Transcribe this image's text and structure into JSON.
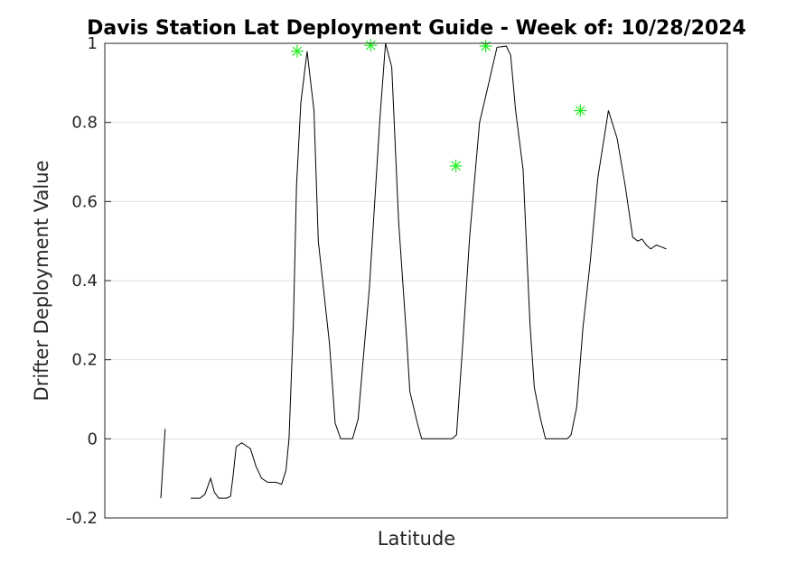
{
  "chart_data": {
    "type": "line",
    "title": "Davis Station Lat Deployment Guide - Week of: 10/28/2024",
    "xlabel": "Latitude",
    "ylabel": "Drifter Deployment Value",
    "xlim": [
      0,
      100
    ],
    "ylim": [
      -0.2,
      1
    ],
    "yticks": [
      -0.2,
      0,
      0.2,
      0.4,
      0.6,
      0.8,
      1
    ],
    "ytick_labels": [
      "-0.2",
      "0",
      "0.2",
      "0.4",
      "0.6",
      "0.8",
      "1"
    ],
    "xticks": [],
    "grid": "horizontal",
    "legend": "none",
    "line_color": "#000000",
    "marker_color": "#22ee22",
    "series": [
      {
        "segments": [
          [
            [
              9.0,
              -0.15
            ],
            [
              9.7,
              0.025
            ]
          ],
          [
            [
              13.8,
              -0.15
            ],
            [
              15.3,
              -0.15
            ],
            [
              16.1,
              -0.14
            ],
            [
              17.0,
              -0.1
            ],
            [
              17.6,
              -0.135
            ],
            [
              18.3,
              -0.15
            ],
            [
              19.6,
              -0.15
            ],
            [
              20.2,
              -0.145
            ],
            [
              20.6,
              -0.095
            ],
            [
              21.1,
              -0.02
            ],
            [
              22.0,
              -0.01
            ],
            [
              23.4,
              -0.025
            ],
            [
              24.3,
              -0.07
            ],
            [
              25.2,
              -0.1
            ],
            [
              26.2,
              -0.11
            ],
            [
              27.5,
              -0.11
            ],
            [
              28.4,
              -0.115
            ],
            [
              29.1,
              -0.08
            ],
            [
              29.6,
              0.0
            ],
            [
              30.3,
              0.3
            ],
            [
              30.8,
              0.64
            ],
            [
              31.5,
              0.85
            ],
            [
              32.5,
              0.98
            ],
            [
              33.6,
              0.83
            ],
            [
              34.3,
              0.5
            ],
            [
              35.0,
              0.4
            ],
            [
              36.1,
              0.24
            ],
            [
              37.0,
              0.04
            ],
            [
              37.9,
              0.0
            ],
            [
              39.8,
              0.0
            ],
            [
              40.7,
              0.05
            ],
            [
              41.4,
              0.18
            ],
            [
              42.5,
              0.38
            ],
            [
              44.2,
              0.81
            ],
            [
              45.1,
              1.0
            ],
            [
              46.1,
              0.94
            ],
            [
              47.2,
              0.55
            ],
            [
              48.5,
              0.25
            ],
            [
              49.0,
              0.12
            ],
            [
              50.2,
              0.04
            ],
            [
              50.9,
              0.0
            ],
            [
              55.8,
              0.0
            ],
            [
              56.5,
              0.01
            ],
            [
              57.5,
              0.24
            ],
            [
              58.6,
              0.51
            ],
            [
              59.6,
              0.69
            ],
            [
              60.2,
              0.8
            ],
            [
              61.4,
              0.88
            ],
            [
              63.0,
              0.99
            ],
            [
              64.5,
              0.993
            ],
            [
              65.2,
              0.97
            ],
            [
              66.0,
              0.83
            ],
            [
              67.2,
              0.68
            ],
            [
              68.3,
              0.29
            ],
            [
              69.0,
              0.13
            ],
            [
              70.0,
              0.05
            ],
            [
              70.8,
              0.0
            ],
            [
              74.3,
              0.0
            ],
            [
              74.9,
              0.01
            ],
            [
              75.8,
              0.08
            ],
            [
              76.8,
              0.28
            ],
            [
              78.0,
              0.45
            ],
            [
              79.2,
              0.66
            ],
            [
              80.4,
              0.78
            ],
            [
              80.9,
              0.83
            ],
            [
              82.3,
              0.76
            ],
            [
              83.6,
              0.64
            ],
            [
              84.8,
              0.51
            ],
            [
              85.6,
              0.5
            ],
            [
              86.3,
              0.505
            ],
            [
              87.0,
              0.49
            ],
            [
              87.7,
              0.48
            ],
            [
              88.6,
              0.49
            ],
            [
              89.4,
              0.485
            ],
            [
              90.2,
              0.48
            ]
          ]
        ]
      }
    ],
    "peaks": [
      {
        "x": 30.9,
        "y": 0.98
      },
      {
        "x": 42.7,
        "y": 0.995
      },
      {
        "x": 56.4,
        "y": 0.69
      },
      {
        "x": 61.2,
        "y": 0.993
      },
      {
        "x": 76.4,
        "y": 0.83
      }
    ]
  }
}
